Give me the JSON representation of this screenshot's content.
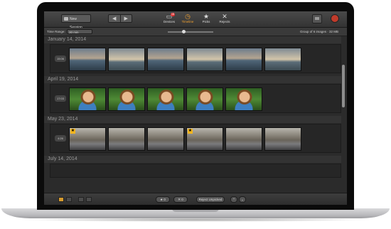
{
  "toolbar": {
    "new_session": "New Session",
    "back_icon": "back-arrow",
    "forward_icon": "forward-arrow",
    "tabs": [
      {
        "label": "Devices",
        "glyph": "▭",
        "badge": "18"
      },
      {
        "label": "Timeline",
        "glyph": "◷"
      },
      {
        "label": "Picks",
        "glyph": "★"
      },
      {
        "label": "Rejects",
        "glyph": "✕"
      }
    ]
  },
  "filter": {
    "time_range_label": "Time Range:",
    "time_range_value": "30 min",
    "group_info": "Group of 6 images · 32 MB",
    "zoom_level": 0.35
  },
  "groups": [
    {
      "date": "January 14, 2014",
      "time": "15:06"
    },
    {
      "date": "April 19, 2014",
      "time": "17:03"
    },
    {
      "date": "May 23, 2014",
      "time": "4:26"
    },
    {
      "date": "July 14, 2014"
    }
  ],
  "bottom": {
    "picks_count": "0",
    "rejects_count": "0",
    "reject_unpicked": "Reject Unpicked",
    "up_glyph": "⌃",
    "down_glyph": "⌄"
  },
  "colors": {
    "accent": "#f0a030",
    "pick_star": "#f3b61f",
    "badge": "#dd3333",
    "record_button": "#c03b2b"
  }
}
